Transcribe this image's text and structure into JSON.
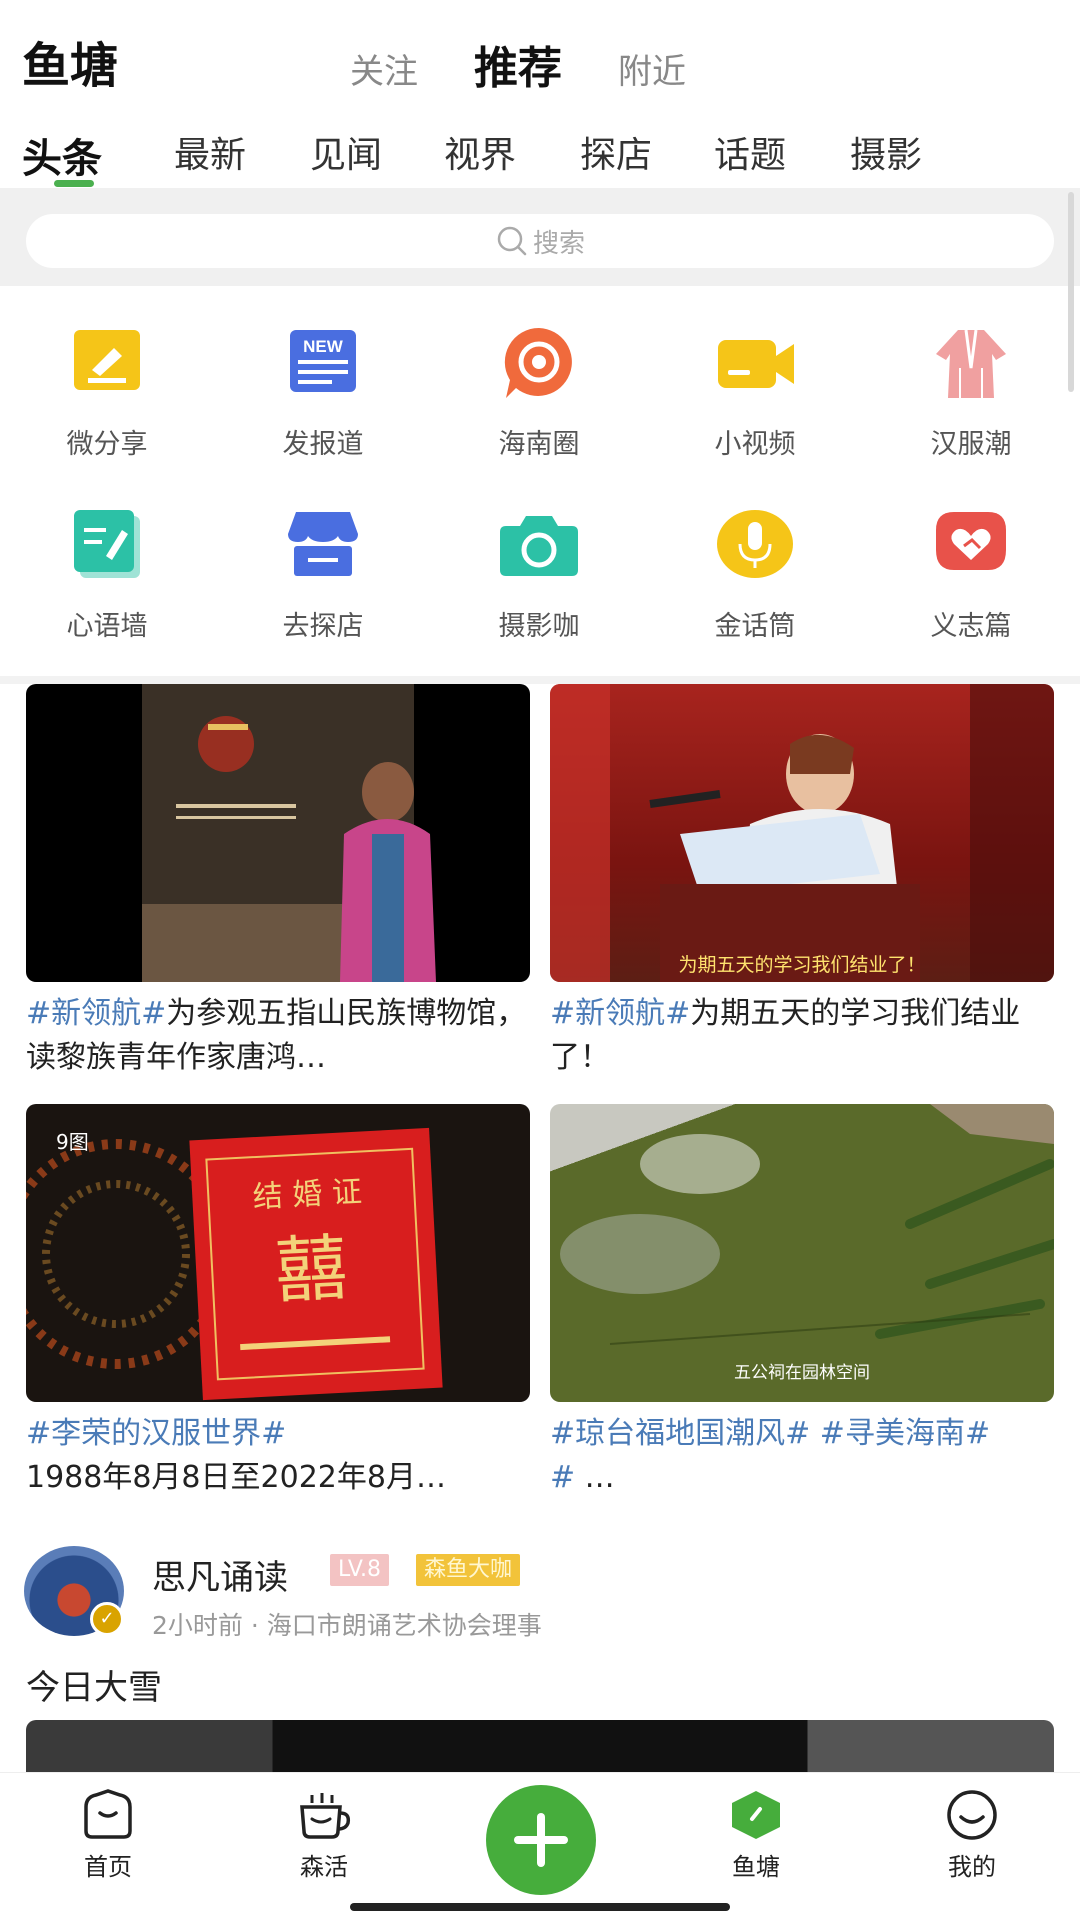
{
  "header": {
    "app_title": "鱼塘",
    "tabs": [
      {
        "label": "关注"
      },
      {
        "label": "推荐"
      },
      {
        "label": "附近"
      }
    ]
  },
  "sub_tabs": [
    {
      "label": "头条"
    },
    {
      "label": "最新"
    },
    {
      "label": "见闻"
    },
    {
      "label": "视界"
    },
    {
      "label": "探店"
    },
    {
      "label": "话题"
    },
    {
      "label": "摄影"
    }
  ],
  "search": {
    "placeholder": "搜索"
  },
  "categories": [
    {
      "label": "微分享",
      "icon": "share-note-icon",
      "color": "#f5c518"
    },
    {
      "label": "发报道",
      "icon": "news-icon",
      "color": "#4a6ee0"
    },
    {
      "label": "海南圈",
      "icon": "circle-chat-icon",
      "color": "#f06a3c"
    },
    {
      "label": "小视频",
      "icon": "video-camera-icon",
      "color": "#f5c518"
    },
    {
      "label": "汉服潮",
      "icon": "hanfu-icon",
      "color": "#f0a0a0"
    },
    {
      "label": "心语墙",
      "icon": "edit-note-icon",
      "color": "#2cc1a6"
    },
    {
      "label": "去探店",
      "icon": "store-icon",
      "color": "#4a6ee0"
    },
    {
      "label": "摄影咖",
      "icon": "camera-icon",
      "color": "#2cc1a6"
    },
    {
      "label": "金话筒",
      "icon": "microphone-icon",
      "color": "#f5c518"
    },
    {
      "label": "义志篇",
      "icon": "heart-hand-icon",
      "color": "#e8524a"
    }
  ],
  "cards": [
    {
      "tag": "#新领航#",
      "text": "为参观五指山民族博物馆，读黎族青年作家唐鸿…",
      "caption": ""
    },
    {
      "tag": "#新领航#",
      "text": "为期五天的学习我们结业了！",
      "caption": "为期五天的学习我们结业了！"
    },
    {
      "tag": "#李荣的汉服世界#",
      "text": "1988年8月8日至2022年8月…",
      "badge": "9图",
      "caption": ""
    },
    {
      "tag": "#琼台福地国潮风# #寻美海南#",
      "text": " …",
      "caption": "五公祠在园林空间"
    }
  ],
  "post": {
    "username": "思凡诵读",
    "level": "LV.8",
    "vip": "森鱼大咖",
    "meta": "2小时前 · 海口市朗诵艺术协会理事",
    "text": "今日大雪"
  },
  "bottom_nav": [
    {
      "label": "首页",
      "icon": "home-icon"
    },
    {
      "label": "森活",
      "icon": "cup-icon"
    },
    {
      "label": "",
      "icon": "plus-icon"
    },
    {
      "label": "鱼塘",
      "icon": "pond-icon"
    },
    {
      "label": "我的",
      "icon": "smile-icon"
    }
  ],
  "colors": {
    "accent": "#4bb04f",
    "tag": "#4a7bb7"
  }
}
